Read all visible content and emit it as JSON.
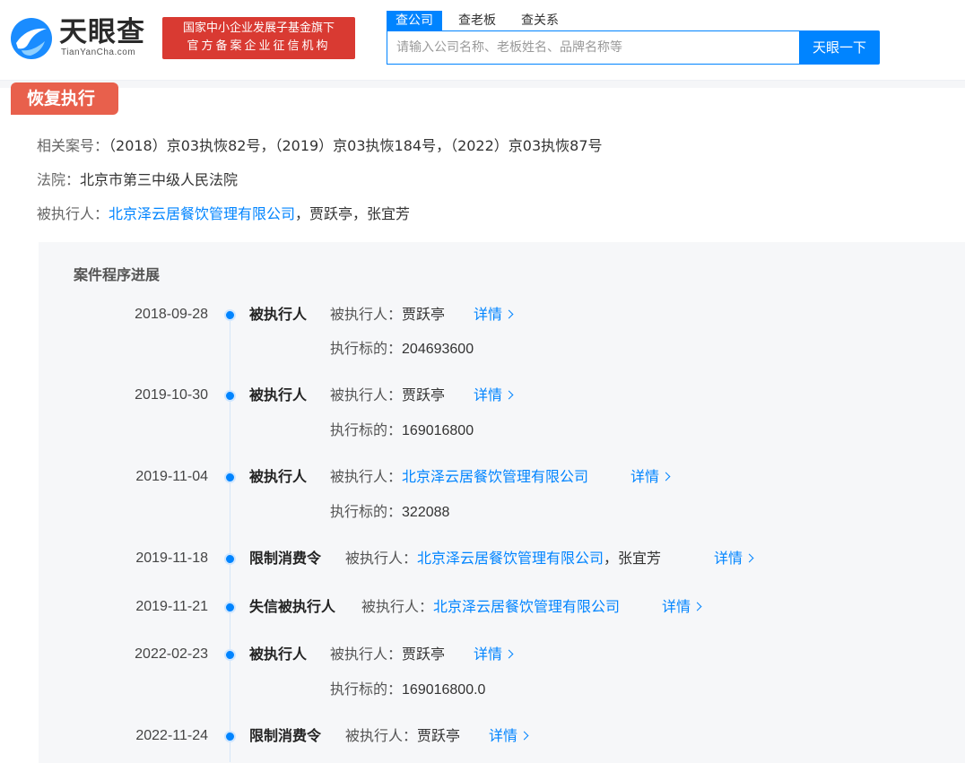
{
  "header": {
    "logo_cn": "天眼查",
    "logo_en": "TianYanCha.com",
    "badge_line1": "国家中小企业发展子基金旗下",
    "badge_line2": "官方备案企业征信机构",
    "tabs": [
      "查公司",
      "查老板",
      "查关系"
    ],
    "search_placeholder": "请输入公司名称、老板姓名、品牌名称等",
    "search_button": "天眼一下",
    "brand_color": "#0084ff"
  },
  "section": {
    "title": "恢复执行",
    "case_label": "相关案号：",
    "case_value": "（2018）京03执恢82号，（2019）京03执恢184号，（2022）京03执恢87号",
    "court_label": "法院：",
    "court_value": "北京市第三中级人民法院",
    "executed_label": "被执行人：",
    "executed_company": "北京泽云居餐饮管理有限公司",
    "executed_rest": "，贾跃亭，张宜芳"
  },
  "timeline": {
    "title": "案件程序进展",
    "detail_label": "详情",
    "entries": [
      {
        "date": "2018-09-28",
        "type": "被执行人",
        "label": "被执行人：",
        "name": "贾跃亭",
        "sub_label": "执行标的：",
        "sub_value": "204693600"
      },
      {
        "date": "2019-10-30",
        "type": "被执行人",
        "label": "被执行人：",
        "name": "贾跃亭",
        "sub_label": "执行标的：",
        "sub_value": "169016800"
      },
      {
        "date": "2019-11-04",
        "type": "被执行人",
        "label": "被执行人：",
        "name": "北京泽云居餐饮管理有限公司",
        "sub_label": "执行标的：",
        "sub_value": "322088"
      },
      {
        "date": "2019-11-18",
        "type": "限制消费令",
        "label": "被执行人：",
        "name": "北京泽云居餐饮管理有限公司",
        "name_extra": "，张宜芳"
      },
      {
        "date": "2019-11-21",
        "type": "失信被执行人",
        "label": "被执行人：",
        "name": "北京泽云居餐饮管理有限公司"
      },
      {
        "date": "2022-02-23",
        "type": "被执行人",
        "label": "被执行人：",
        "name": "贾跃亭",
        "sub_label": "执行标的：",
        "sub_value": "169016800.0"
      },
      {
        "date": "2022-11-24",
        "type": "限制消费令",
        "label": "被执行人：",
        "name": "贾跃亭"
      }
    ]
  }
}
